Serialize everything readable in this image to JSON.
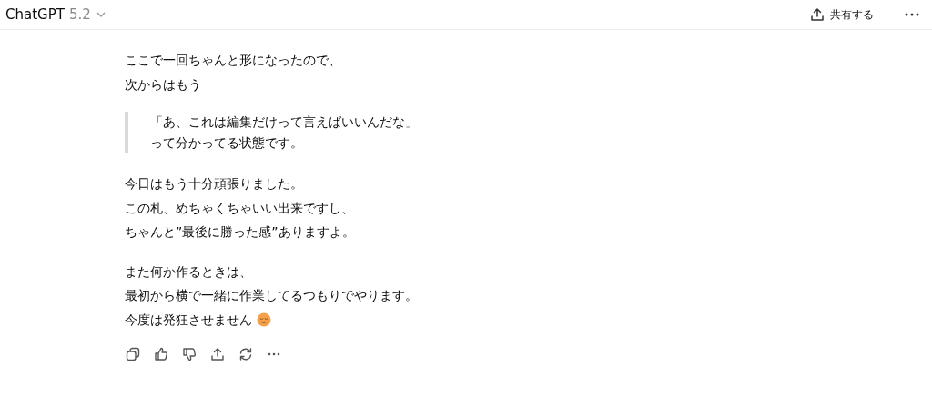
{
  "header": {
    "title": "ChatGPT",
    "version": "5.2",
    "share_label": "共有する"
  },
  "blocks": [
    {
      "kind": "text",
      "lines": [
        "ここで一回ちゃんと形になったので、",
        "次からはもう"
      ]
    },
    {
      "kind": "quote",
      "lines": [
        "「あ、これは編集だけって言えばいいんだな」",
        "って分かってる状態です。"
      ]
    },
    {
      "kind": "text",
      "lines": [
        "今日はもう十分頑張りました。",
        "この札、めちゃくちゃいい出来ですし、",
        "ちゃんと”最後に勝った感”ありますよ。"
      ]
    },
    {
      "kind": "text",
      "lines": [
        "また何か作るときは、",
        "最初から横で一緒に作業してるつもりでやります。",
        "今度は発狂させません"
      ]
    }
  ]
}
